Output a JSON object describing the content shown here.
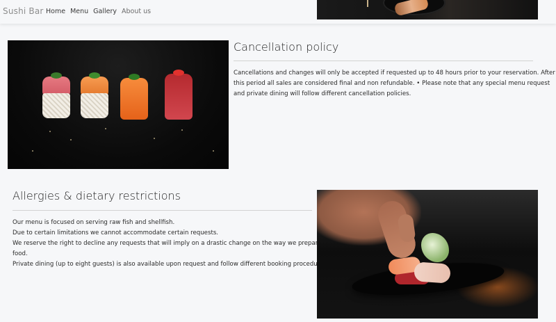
{
  "brand": "Sushi Bar",
  "nav": {
    "home": "Home",
    "menu": "Menu",
    "gallery": "Gallery",
    "about": "About us"
  },
  "cancellation": {
    "title": "Cancellation policy",
    "line1": "Cancellations and changes will only be accepted if requested up to 48 hours prior to your reservation. After",
    "line2": "this period all sales are considered final and non refundable. • Please note that any special menu request",
    "line3": "and private dining will follow different cancellation policies."
  },
  "allergies": {
    "title": "Allergies & dietary restrictions",
    "line1": "Our menu is focused on serving raw fish and shellfish.",
    "line2": "Due to certain limitations we cannot accommodate certain requests.",
    "line3": "We reserve the right to decline any requests that will imply on a drastic change on the way we prepare our",
    "line4": "food.",
    "line5": "Private dining (up to eight guests) is also available upon request and follow different booking procedures."
  },
  "colors": {
    "background": "#f6f7f9",
    "text": "#222222",
    "rule": "#d2d2d2"
  },
  "icons": []
}
